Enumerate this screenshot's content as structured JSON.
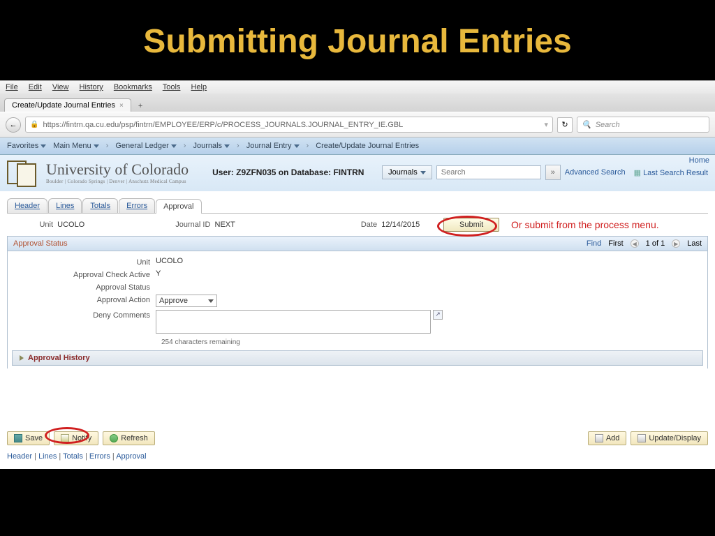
{
  "slide": {
    "title": "Submitting Journal Entries"
  },
  "menubar": {
    "file": "File",
    "edit": "Edit",
    "view": "View",
    "history": "History",
    "bookmarks": "Bookmarks",
    "tools": "Tools",
    "help": "Help"
  },
  "tab": {
    "title": "Create/Update Journal Entries"
  },
  "url": "https://fintrn.qa.cu.edu/psp/fintrn/EMPLOYEE/ERP/c/PROCESS_JOURNALS.JOURNAL_ENTRY_IE.GBL",
  "browser_search_placeholder": "Search",
  "breadcrumb": {
    "favorites": "Favorites",
    "main": "Main Menu",
    "gl": "General Ledger",
    "journals": "Journals",
    "je": "Journal Entry",
    "final": "Create/Update Journal Entries"
  },
  "header": {
    "home": "Home",
    "uni_big": "University of Colorado",
    "uni_small": "Boulder | Colorado Springs | Denver | Anschutz Medical Campus",
    "user_db": "User: Z9ZFN035 on Database: FINTRN",
    "search_label": "Journals",
    "search_placeholder": "Search",
    "adv": "Advanced Search",
    "last": "Last Search Result"
  },
  "tabs": {
    "header": "Header",
    "lines": "Lines",
    "totals": "Totals",
    "errors": "Errors",
    "approval": "Approval"
  },
  "info": {
    "unit_label": "Unit",
    "unit_val": "UCOLO",
    "jid_label": "Journal ID",
    "jid_val": "NEXT",
    "date_label": "Date",
    "date_val": "12/14/2015",
    "submit": "Submit"
  },
  "annotation": "Or submit from the process menu.",
  "section": {
    "title": "Approval Status",
    "find": "Find",
    "first": "First",
    "pos": "1 of 1",
    "last": "Last"
  },
  "form": {
    "unit_l": "Unit",
    "unit_v": "UCOLO",
    "check_l": "Approval Check Active",
    "check_v": "Y",
    "status_l": "Approval Status",
    "action_l": "Approval Action",
    "action_v": "Approve",
    "deny_l": "Deny Comments",
    "remaining": "254 characters remaining"
  },
  "history": "Approval History",
  "buttons": {
    "save": "Save",
    "notify": "Notify",
    "refresh": "Refresh",
    "add": "Add",
    "update": "Update/Display"
  },
  "footer": {
    "header": "Header",
    "lines": "Lines",
    "totals": "Totals",
    "errors": "Errors",
    "approval": "Approval"
  }
}
